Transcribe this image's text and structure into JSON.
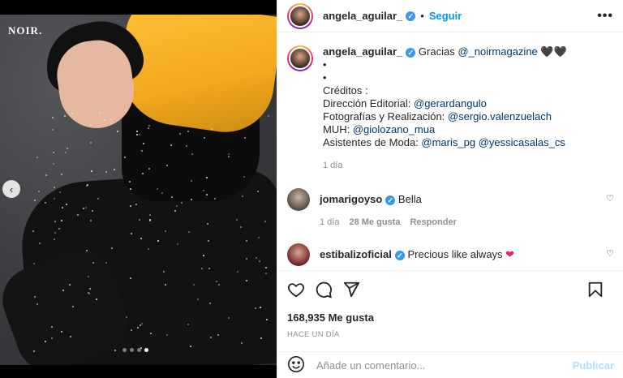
{
  "media": {
    "brand_text": "NOIR.",
    "carousel": {
      "total": 4,
      "active_index": 3
    }
  },
  "post": {
    "author": "angela_aguilar_",
    "follow_label": "Seguir",
    "separator": "•",
    "more_label": "•••",
    "caption": {
      "author": "angela_aguilar_",
      "text_prefix": "Gracias ",
      "mention": "@_noirmagazine",
      "hearts": "🖤🖤",
      "bullet1": "•",
      "bullet2": "•",
      "credits_title": "Créditos :",
      "lines": [
        {
          "label": "Dirección Editorial: ",
          "mention": "@gerardangulo"
        },
        {
          "label": "Fotografías y Realización: ",
          "mention": "@sergio.valenzuelach"
        },
        {
          "label": "MUH: ",
          "mention": "@giolozano_mua"
        },
        {
          "label": "Asistentes de Moda: ",
          "mention": "@maris_pg",
          "mention2": "@yessicasalas_cs"
        }
      ],
      "time": "1 día"
    },
    "comments": [
      {
        "user": "jomarigoyso",
        "text": "Bella",
        "time": "1 día",
        "likes": "28 Me gusta",
        "reply": "Responder"
      },
      {
        "user": "estibalizoficial",
        "text": "Precious like always ",
        "heart": "❤"
      }
    ],
    "likes": "168,935 Me gusta",
    "posted": "HACE UN DÍA",
    "add_comment_placeholder": "Añade un comentario...",
    "publish_label": "Publicar"
  },
  "colors": {
    "link": "#0095f6",
    "mention": "#00376b",
    "verified": "#3897f0",
    "muted": "#8e8e8e"
  }
}
